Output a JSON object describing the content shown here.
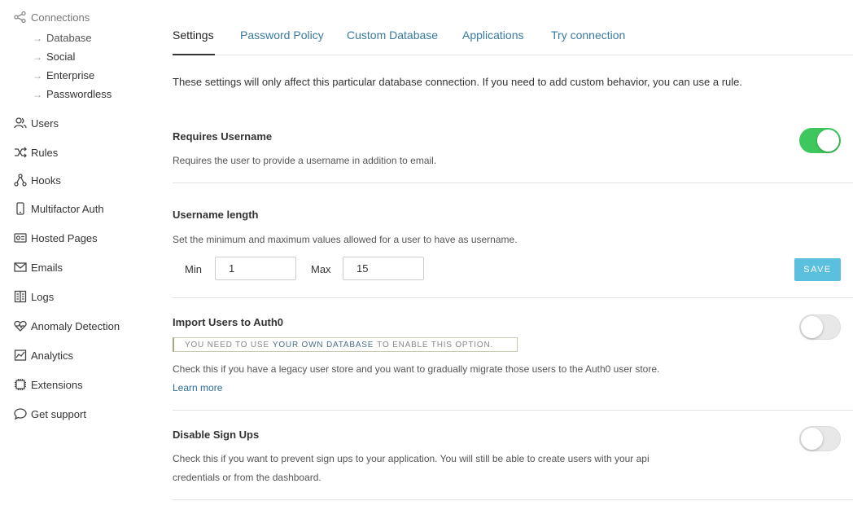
{
  "sidebar": {
    "connections": "Connections",
    "sub_items": [
      {
        "label": "Database"
      },
      {
        "label": "Social"
      },
      {
        "label": "Enterprise"
      },
      {
        "label": "Passwordless"
      }
    ],
    "items": [
      {
        "label": "Users",
        "icon": "users-icon"
      },
      {
        "label": "Rules",
        "icon": "rules-icon"
      },
      {
        "label": "Hooks",
        "icon": "hooks-icon"
      },
      {
        "label": "Multifactor Auth",
        "icon": "phone-icon"
      },
      {
        "label": "Hosted Pages",
        "icon": "hosted-pages-icon"
      },
      {
        "label": "Emails",
        "icon": "mail-icon"
      },
      {
        "label": "Logs",
        "icon": "logs-icon"
      },
      {
        "label": "Anomaly Detection",
        "icon": "heart-icon"
      },
      {
        "label": "Analytics",
        "icon": "analytics-icon"
      },
      {
        "label": "Extensions",
        "icon": "chip-icon"
      },
      {
        "label": "Get support",
        "icon": "chat-icon"
      }
    ]
  },
  "tabs": [
    {
      "label": "Settings",
      "active": true
    },
    {
      "label": "Password Policy"
    },
    {
      "label": "Custom Database"
    },
    {
      "label": "Applications"
    },
    {
      "label": "Try connection"
    }
  ],
  "intro": "These settings will only affect this particular database connection. If you need to add custom behavior, you can use a rule.",
  "requires_username": {
    "title": "Requires Username",
    "desc": "Requires the user to provide a username in addition to email.",
    "enabled": true
  },
  "username_length": {
    "title": "Username length",
    "desc": "Set the minimum and maximum values allowed for a user to have as username.",
    "min_label": "Min",
    "min_value": "1",
    "max_label": "Max",
    "max_value": "15",
    "save_label": "SAVE"
  },
  "import_users": {
    "title": "Import Users to Auth0",
    "notice_pre": "YOU NEED TO USE",
    "notice_highlight": "YOUR OWN DATABASE",
    "notice_post": "TO ENABLE THIS OPTION.",
    "desc": "Check this if you have a legacy user store and you want to gradually migrate those users to the Auth0 user store.",
    "learn_more": "Learn more",
    "enabled": false
  },
  "disable_signups": {
    "title": "Disable Sign Ups",
    "desc_line1": "Check this if you want to prevent sign ups to your application. You will still be able to create users with your api",
    "desc_line2": "credentials or from the dashboard.",
    "enabled": false
  },
  "colors": {
    "toggle_on": "#3ec75d",
    "save_button": "#5bc0de",
    "tab_link": "#3a7aa0"
  }
}
